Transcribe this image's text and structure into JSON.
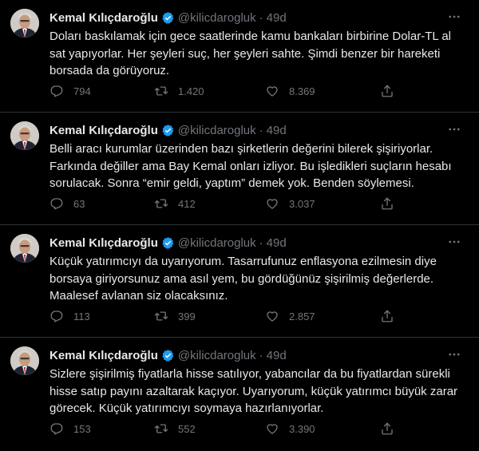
{
  "tweets": [
    {
      "name": "Kemal Kılıçdaroğlu",
      "handle": "@kilicdarogluk",
      "separator": "·",
      "time": "49d",
      "text": "Doları baskılamak için gece saatlerinde kamu bankaları birbirine Dolar-TL al sat yapıyorlar. Her şeyleri suç, her şeyleri sahte. Şimdi benzer bir hareketi borsada da görüyoruz.",
      "replies": "794",
      "retweets": "1.420",
      "likes": "8.369"
    },
    {
      "name": "Kemal Kılıçdaroğlu",
      "handle": "@kilicdarogluk",
      "separator": "·",
      "time": "49d",
      "text": "Belli aracı kurumlar üzerinden bazı şirketlerin değerini bilerek şişiriyorlar. Farkında değiller ama Bay Kemal onları izliyor. Bu işledikleri suçların hesabı sorulacak. Sonra “emir geldi, yaptım” demek yok. Benden söylemesi.",
      "replies": "63",
      "retweets": "412",
      "likes": "3.037"
    },
    {
      "name": "Kemal Kılıçdaroğlu",
      "handle": "@kilicdarogluk",
      "separator": "·",
      "time": "49d",
      "text": "Küçük yatırımcıyı da uyarıyorum. Tasarrufunuz enflasyona ezilmesin diye borsaya giriyorsunuz ama asıl yem, bu gördüğünüz şişirilmiş değerlerde. Maalesef avlanan siz olacaksınız.",
      "replies": "113",
      "retweets": "399",
      "likes": "2.857"
    },
    {
      "name": "Kemal Kılıçdaroğlu",
      "handle": "@kilicdarogluk",
      "separator": "·",
      "time": "49d",
      "text": "Sizlere şişirilmiş fiyatlarla hisse satılıyor, yabancılar da bu fiyatlardan sürekli hisse satıp payını azaltarak kaçıyor. Uyarıyorum, küçük yatırımcı büyük zarar görecek. Küçük yatırımcıyı soymaya hazırlanıyorlar.",
      "replies": "153",
      "retweets": "552",
      "likes": "3.390"
    }
  ],
  "colors": {
    "background": "#000000",
    "text": "#e7e9ea",
    "secondary": "#71767b",
    "verified": "#1d9bf0",
    "divider": "#2f3336"
  },
  "icons": [
    "verified-badge-icon",
    "more-icon",
    "reply-icon",
    "retweet-icon",
    "like-icon",
    "share-icon"
  ]
}
